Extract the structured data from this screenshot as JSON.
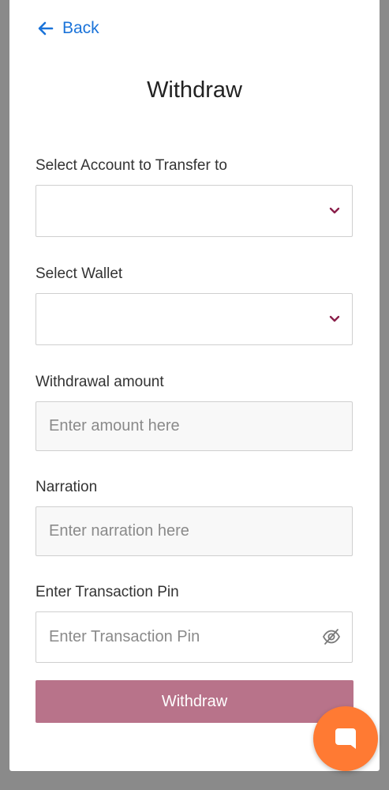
{
  "header": {
    "back_label": "Back",
    "title": "Withdraw"
  },
  "form": {
    "account": {
      "label": "Select Account to Transfer to",
      "value": ""
    },
    "wallet": {
      "label": "Select Wallet",
      "value": ""
    },
    "amount": {
      "label": "Withdrawal amount",
      "placeholder": "Enter amount here"
    },
    "narration": {
      "label": "Narration",
      "placeholder": "Enter narration here"
    },
    "pin": {
      "label": "Enter Transaction Pin",
      "placeholder": "Enter Transaction Pin"
    },
    "submit_label": "Withdraw"
  },
  "icons": {
    "back": "arrow-left-icon",
    "dropdown": "chevron-down-icon",
    "visibility": "eye-off-icon",
    "chat": "chat-bubble-icon"
  },
  "colors": {
    "link": "#1a73d9",
    "chevron": "#8a1f4a",
    "button": "#b8738a",
    "chat_fab": "#ff7a33"
  }
}
